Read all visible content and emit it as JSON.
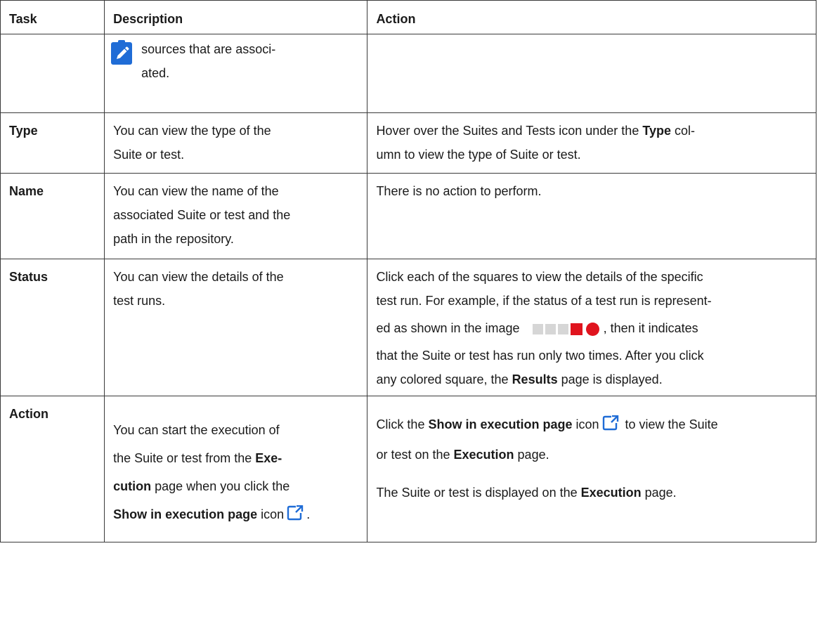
{
  "headers": {
    "task": "Task",
    "description": "Description",
    "action": "Action"
  },
  "note_row": {
    "desc_line1": "sources that are associ-",
    "desc_line2": "ated."
  },
  "rows": {
    "type": {
      "task": "Type",
      "desc_line1": "You can view the type of the",
      "desc_line2": "Suite or test.",
      "act_line1_a": "Hover over the Suites and Tests icon under the ",
      "act_line1_b": "Type",
      "act_line1_c": " col-",
      "act_line2": "umn to view the type of Suite or test."
    },
    "name": {
      "task": "Name",
      "desc_line1": "You can view the name of the",
      "desc_line2": "associated Suite or test and the",
      "desc_line3": "path in the repository.",
      "action": "There is no action to perform."
    },
    "status": {
      "task": "Status",
      "desc_line1": "You can view the details of the",
      "desc_line2": "test runs.",
      "act_line1": "Click each of the squares to view the details of the specific",
      "act_line2": "test run. For example, if the status of a test run is represent-",
      "act_line3_a": "ed as shown in the image",
      "act_line3_b": ", then it indicates",
      "act_line4": "that the Suite or test has run only two times. After you click",
      "act_line5_a": "any colored square, the ",
      "act_line5_b": "Results",
      "act_line5_c": " page is displayed."
    },
    "action": {
      "task": "Action",
      "desc_line1": "You can start the execution of",
      "desc_line2_a": "the Suite or test from the ",
      "desc_line2_b": "Exe-",
      "desc_line3_a": "cution",
      "desc_line3_b": " page when you click the",
      "desc_line4_a": "Show in execution page",
      "desc_line4_b": " icon",
      "desc_line4_c": ".",
      "act_p1_a": "Click the ",
      "act_p1_b": "Show in execution page",
      "act_p1_c": " icon",
      "act_p1_d": " to view the Suite",
      "act_p1_e": "or test on the ",
      "act_p1_f": "Execution",
      "act_p1_g": " page.",
      "act_p2_a": "The Suite or test is displayed on the ",
      "act_p2_b": "Execution",
      "act_p2_c": " page."
    }
  },
  "icons": {
    "note": "note-pencil-icon",
    "external": "open-external-icon",
    "accent": "#1f6cd6",
    "status_gray": "#d6d6d6",
    "status_red": "#e0141e"
  }
}
